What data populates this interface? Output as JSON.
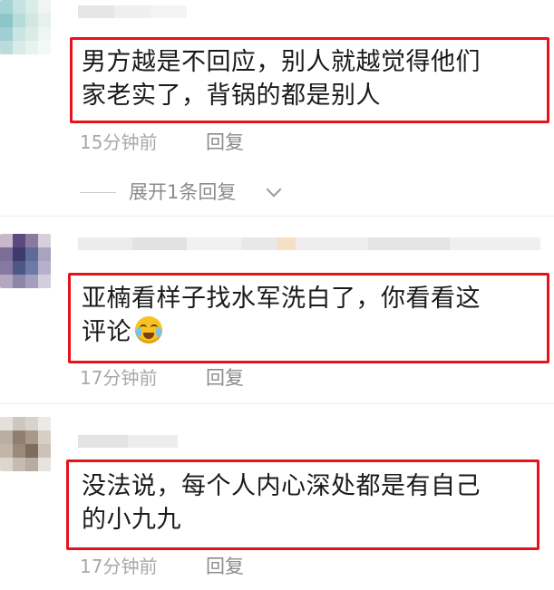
{
  "comments": [
    {
      "text_lines": [
        "男方越是不回应，别人就越觉得他们",
        "家老实了，背锅的都是别人"
      ],
      "time": "15分钟前",
      "reply_label": "回复",
      "expand_label": "展开1条回复"
    },
    {
      "text_lines": [
        "亚楠看样子找水军洗白了，你看看这",
        "评论"
      ],
      "emoji": "laughing-crying-emoji",
      "time": "17分钟前",
      "reply_label": "回复"
    },
    {
      "text_lines": [
        "没法说，每个人内心深处都是有自己",
        "的小九九"
      ],
      "time": "17分钟前",
      "reply_label": "回复"
    }
  ],
  "colors": {
    "highlight_border": "#e5141a",
    "meta_text": "#a8a8a8",
    "body_text": "#1a1a1a"
  }
}
